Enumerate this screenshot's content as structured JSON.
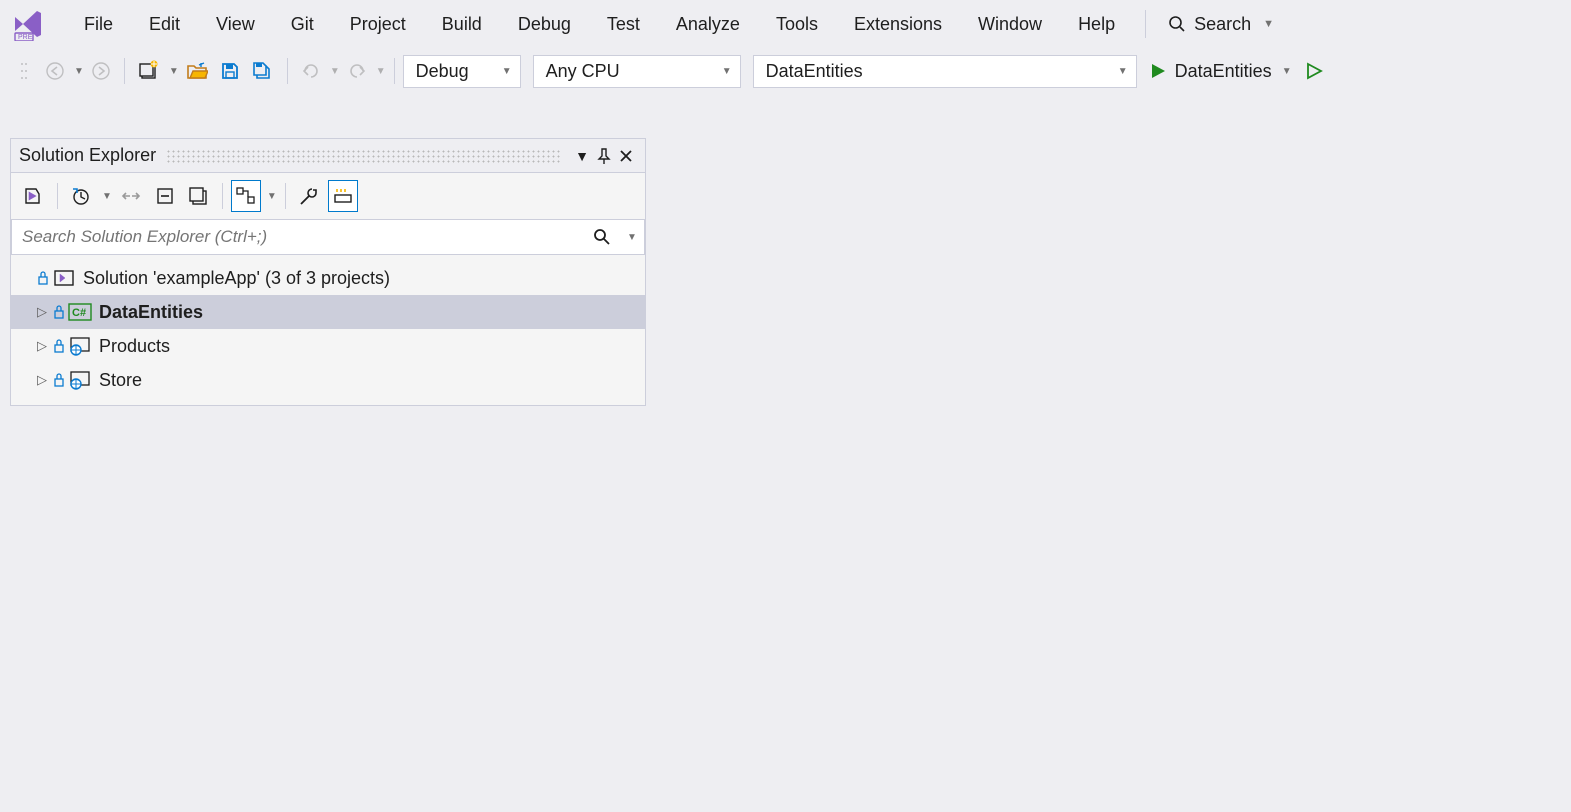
{
  "menubar": {
    "items": [
      "File",
      "Edit",
      "View",
      "Git",
      "Project",
      "Build",
      "Debug",
      "Test",
      "Analyze",
      "Tools",
      "Extensions",
      "Window",
      "Help"
    ],
    "search_label": "Search"
  },
  "toolbar": {
    "configuration": "Debug",
    "platform": "Any CPU",
    "startup_project": "DataEntities",
    "run_label": "DataEntities"
  },
  "solution_explorer": {
    "title": "Solution Explorer",
    "search_placeholder": "Search Solution Explorer (Ctrl+;)",
    "solution_label": "Solution 'exampleApp' (3 of 3 projects)",
    "projects": [
      {
        "name": "DataEntities",
        "type": "csharp",
        "selected": true
      },
      {
        "name": "Products",
        "type": "web",
        "selected": false
      },
      {
        "name": "Store",
        "type": "web",
        "selected": false
      }
    ]
  }
}
